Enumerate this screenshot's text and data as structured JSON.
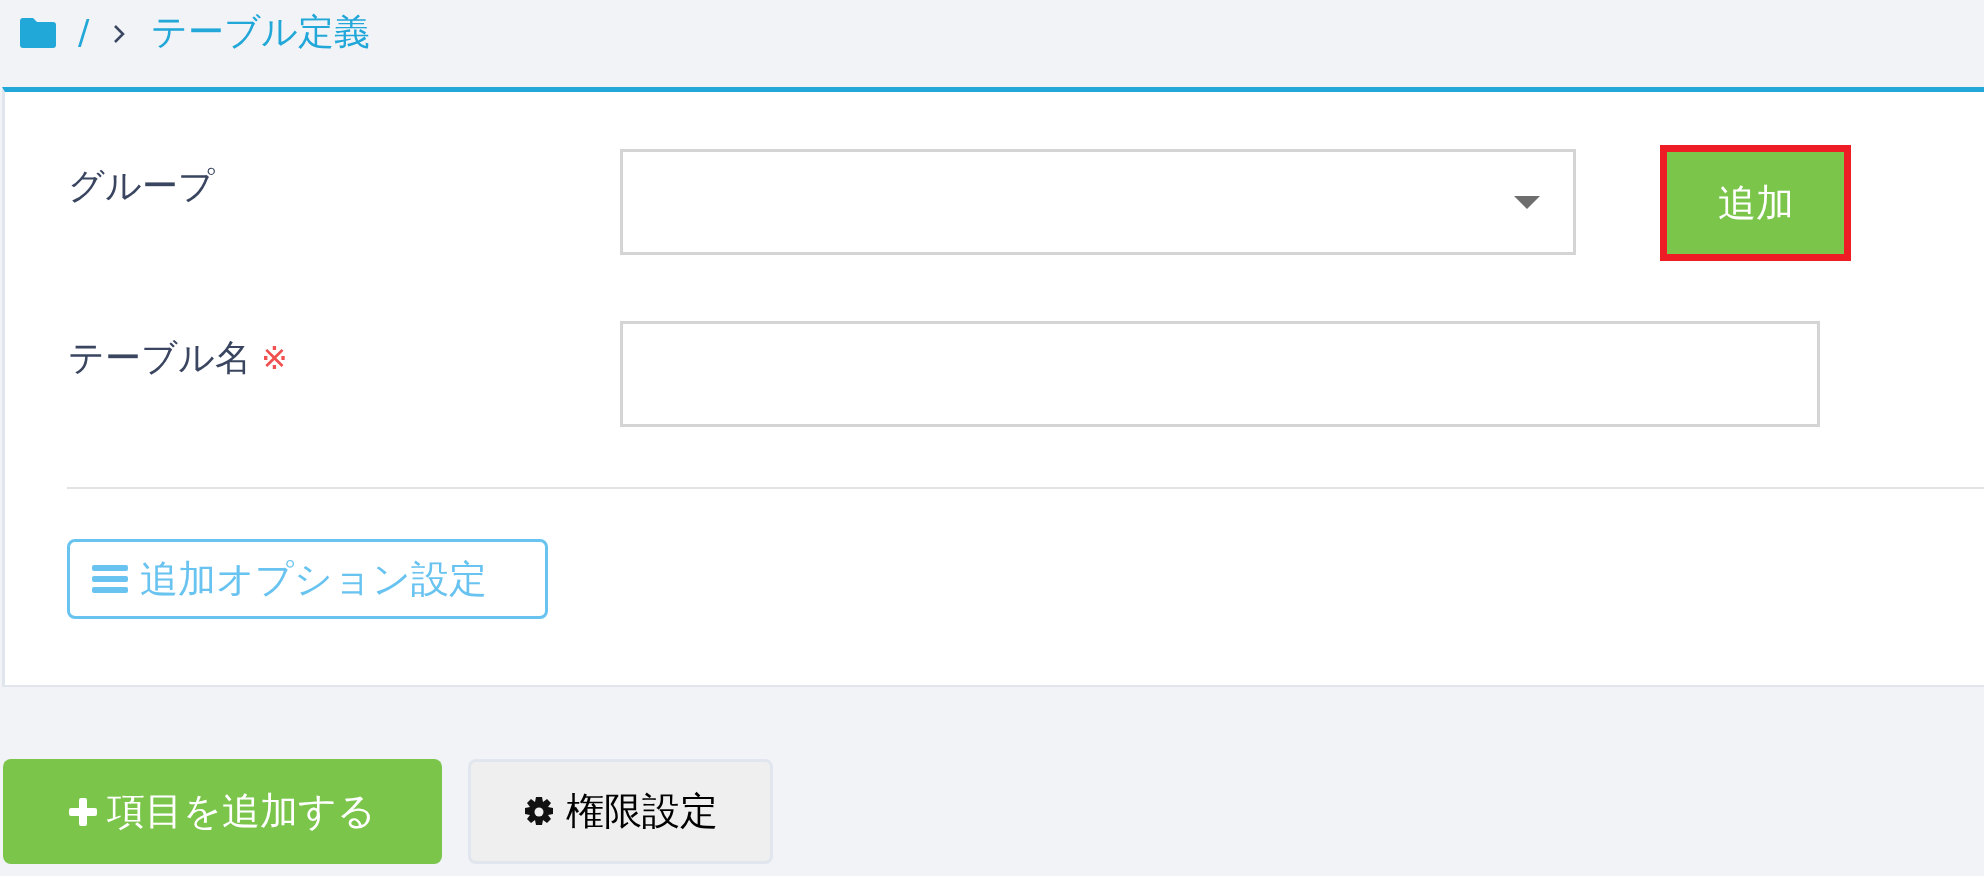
{
  "breadcrumb": {
    "separator": "/",
    "current": "テーブル定義"
  },
  "form": {
    "fields": [
      {
        "kind": "select",
        "label": "グループ",
        "button": {
          "label": "追加",
          "highlighted": true
        }
      },
      {
        "kind": "text",
        "label": "テーブル名",
        "required_mark": "※"
      }
    ],
    "options_button": "追加オプション設定"
  },
  "actions": [
    {
      "kind": "primary",
      "label": "項目を追加する"
    },
    {
      "kind": "secondary",
      "label": "権限設定"
    }
  ]
}
